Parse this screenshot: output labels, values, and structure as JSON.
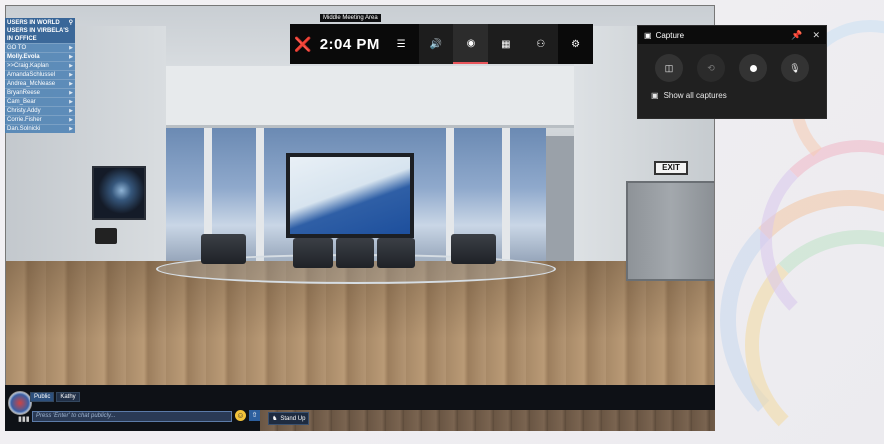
{
  "scene": {
    "room_label": "Middle Meeting Area",
    "exit_sign": "EXIT"
  },
  "users_panel": {
    "header": "USERS IN WORLD",
    "subheader_1": "USERS IN VIRBELA'S",
    "subheader_2": "IN OFFICE",
    "goto": "GO TO",
    "users": [
      "Molly.Evola",
      ">>Craig.Kaplan",
      "AmandaSchlussel",
      "Andrea_McNease",
      "BryanReese",
      "Cam_Bear",
      "Christy.Addy",
      "Corrie.Fisher",
      "Dan.Solnicki"
    ]
  },
  "chat": {
    "tab_public": "Public",
    "tab_user": "Kathy",
    "input_placeholder": "Press 'Enter' to chat publicly...",
    "stand_up_label": "Stand Up"
  },
  "gamebar": {
    "time": "2:04 PM",
    "icons": [
      "xbox-icon",
      "menu-icon",
      "audio-icon",
      "capture-icon",
      "performance-icon",
      "social-icon",
      "settings-icon"
    ]
  },
  "capture": {
    "title": "Capture",
    "show_all_label": "Show all captures"
  },
  "colors": {
    "accent": "#e8555b",
    "panel_blue": "#4a80b4",
    "gamebar_bg": "#0a0a0a"
  }
}
